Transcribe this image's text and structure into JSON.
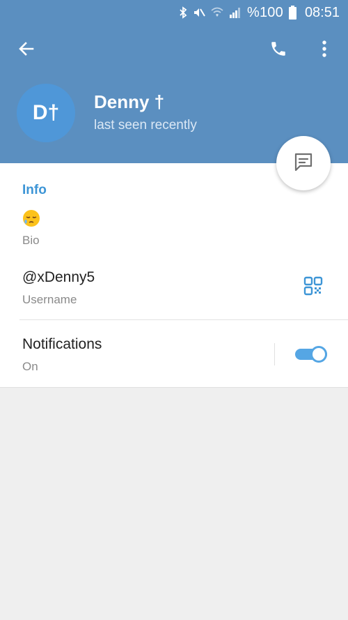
{
  "status_bar": {
    "battery": "%100",
    "time": "08:51",
    "icons": [
      "bluetooth-icon",
      "mute-icon",
      "wifi-icon",
      "signal-icon",
      "battery-icon"
    ]
  },
  "toolbar": {
    "back_icon": "arrow-back-icon",
    "call_icon": "phone-icon",
    "more_icon": "more-vert-icon"
  },
  "profile": {
    "avatar_initials": "D†",
    "name": "Denny †",
    "status": "last seen recently",
    "avatar_color": "#4f97d8"
  },
  "fab": {
    "icon": "message-icon"
  },
  "info": {
    "section_title": "Info",
    "bio_value": "😪",
    "bio_label": "Bio",
    "username_value": "@xDenny5",
    "username_label": "Username",
    "qr_icon": "qr-code-icon",
    "notifications_label": "Notifications",
    "notifications_value": "On",
    "notifications_enabled": true
  },
  "colors": {
    "header": "#5b8fc0",
    "accent": "#3d95d6",
    "toggle": "#55a6e4",
    "background": "#efefef"
  }
}
